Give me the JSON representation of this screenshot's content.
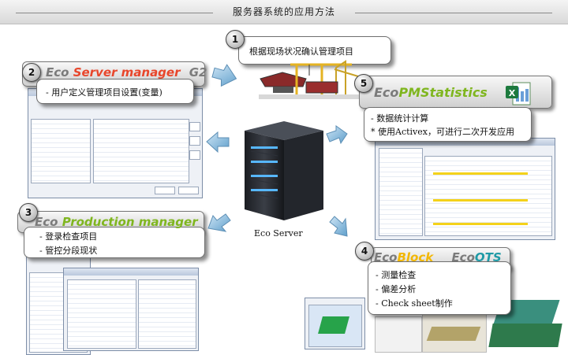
{
  "header": {
    "title": "服务器系统的应用方法"
  },
  "steps": [
    {
      "number": "1",
      "text": "根据现场状况确认管理项目"
    },
    {
      "number": "2",
      "brand": [
        "Eco",
        "Server manager",
        "G2"
      ],
      "lines": [
        "- 用户定义管理项目设置(变量)"
      ]
    },
    {
      "number": "3",
      "brand": [
        "Eco",
        "Production manager"
      ],
      "lines": [
        "-     登录检查项目",
        "-     管控分段现状"
      ]
    },
    {
      "number": "4",
      "brand": [
        "Eco",
        "Block",
        "Eco",
        "OTS"
      ],
      "lines": [
        "-        测量检查",
        "-        偏差分析",
        "-        Check sheet制作"
      ]
    },
    {
      "number": "5",
      "brand": [
        "Eco",
        "PMStatistics"
      ],
      "lines": [
        "- 数据统计计算",
        "* 使用Activex，可进行二次开发应用"
      ]
    }
  ],
  "server": {
    "label": "Eco Server"
  },
  "colors": {
    "server_red": "#e8462b",
    "production_green": "#7fb61f",
    "block_yellow": "#f2b705",
    "ots_teal": "#1f9aa6",
    "arrow": "#6aa5cf"
  },
  "icons": [
    "shipyard-cranes-icon",
    "excel-icon",
    "server-icon"
  ]
}
